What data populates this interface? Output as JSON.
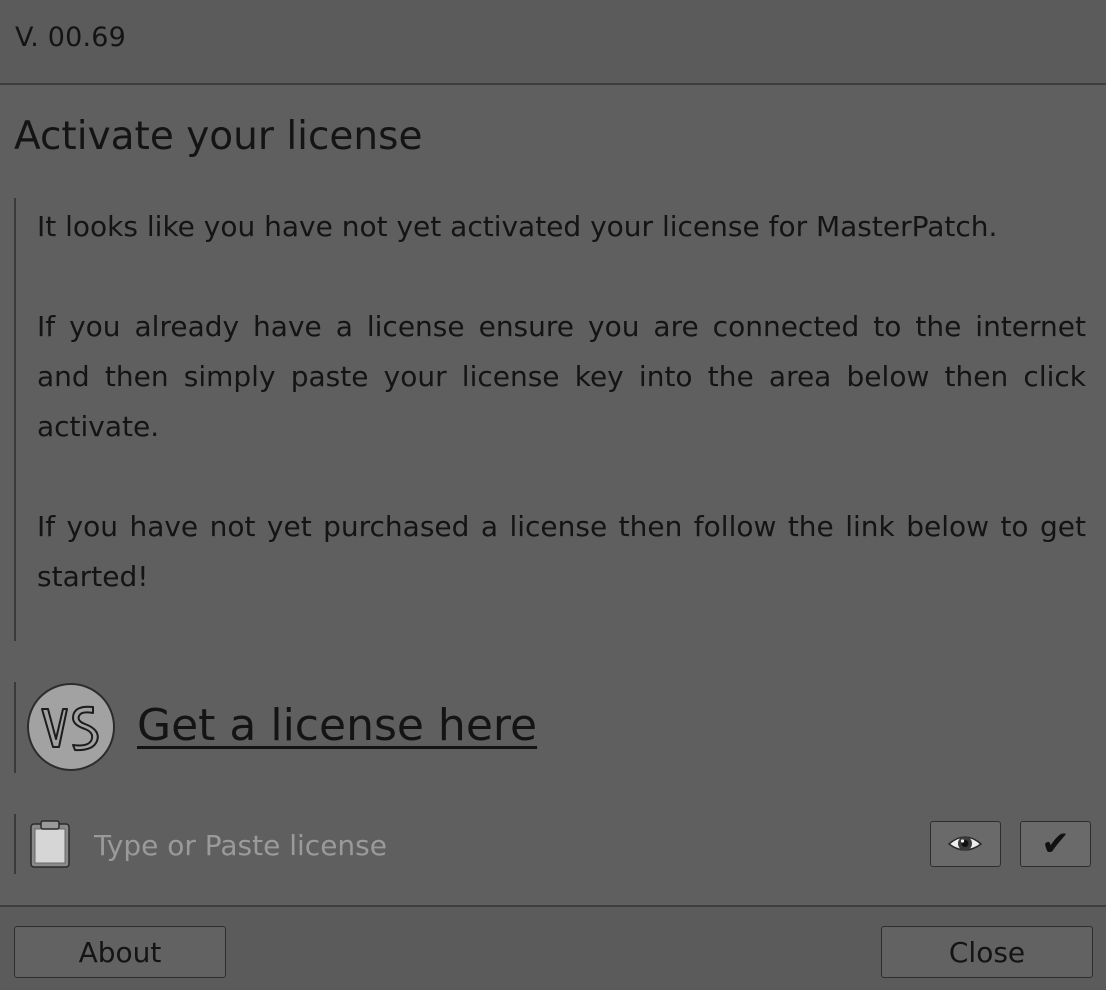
{
  "header": {
    "version": "V. 00.69"
  },
  "main": {
    "title": "Activate your license",
    "paragraphs": [
      "It looks like you have not yet activated your license for MasterPatch.",
      "If you already have a license ensure you are connected to the internet and then simply paste your license key into the area below then click activate.",
      "If you have not yet purchased a license then follow the link below to get started!"
    ],
    "license_link": {
      "logo_text": "VS",
      "label": "Get a license here"
    },
    "license_input": {
      "placeholder": "Type or Paste license",
      "value": "",
      "paste_icon": "clipboard-icon",
      "show_icon": "eye-icon",
      "activate_icon": "checkmark-icon",
      "activate_glyph": "✔"
    }
  },
  "footer": {
    "about_label": "About",
    "close_label": "Close"
  },
  "colors": {
    "background": "#5f5f5f",
    "bar": "#5b5b5b",
    "text": "#141414",
    "placeholder": "#9a9a9a",
    "logo_fill": "#a2a2a2"
  }
}
